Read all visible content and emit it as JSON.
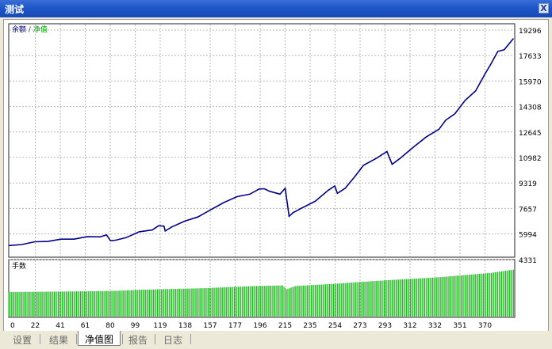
{
  "window": {
    "title": "测试",
    "close_label": "X"
  },
  "chart": {
    "legend_balance": "余额",
    "legend_sep": " / ",
    "legend_equity": "净值",
    "lower_label": "手数",
    "balance_color": "#00008b",
    "equity_color": "#00a000",
    "volume_color": "#00b000"
  },
  "chart_data": {
    "type": "line",
    "y_ticks": [
      "19296",
      "17633",
      "15970",
      "14308",
      "12645",
      "10982",
      "9319",
      "7657",
      "5994",
      "4331"
    ],
    "x_ticks": [
      "0",
      "22",
      "41",
      "61",
      "80",
      "99",
      "119",
      "138",
      "157",
      "177",
      "196",
      "215",
      "235",
      "254",
      "273",
      "293",
      "312",
      "332",
      "351",
      "370"
    ],
    "ylim": [
      4331,
      19296
    ],
    "balance": [
      [
        0,
        5000
      ],
      [
        10,
        5150
      ],
      [
        20,
        5250
      ],
      [
        30,
        5350
      ],
      [
        40,
        5420
      ],
      [
        50,
        5500
      ],
      [
        60,
        5580
      ],
      [
        70,
        5650
      ],
      [
        75,
        5700
      ],
      [
        78,
        5400
      ],
      [
        82,
        5350
      ],
      [
        90,
        5600
      ],
      [
        100,
        5900
      ],
      [
        110,
        6100
      ],
      [
        115,
        6300
      ],
      [
        119,
        6350
      ],
      [
        120,
        5950
      ],
      [
        125,
        6300
      ],
      [
        135,
        6600
      ],
      [
        145,
        6950
      ],
      [
        155,
        7350
      ],
      [
        165,
        7900
      ],
      [
        175,
        8200
      ],
      [
        185,
        8450
      ],
      [
        192,
        8700
      ],
      [
        196,
        8800
      ],
      [
        200,
        8550
      ],
      [
        208,
        8450
      ],
      [
        212,
        8750
      ],
      [
        215,
        7000
      ],
      [
        218,
        7150
      ],
      [
        225,
        7550
      ],
      [
        235,
        7900
      ],
      [
        245,
        8700
      ],
      [
        250,
        8900
      ],
      [
        252,
        8500
      ],
      [
        258,
        8750
      ],
      [
        265,
        9550
      ],
      [
        272,
        10250
      ],
      [
        282,
        10800
      ],
      [
        290,
        11150
      ],
      [
        294,
        10400
      ],
      [
        300,
        10700
      ],
      [
        310,
        11500
      ],
      [
        320,
        12100
      ],
      [
        330,
        12700
      ],
      [
        335,
        13200
      ],
      [
        342,
        13700
      ],
      [
        350,
        14500
      ],
      [
        358,
        15200
      ],
      [
        365,
        16200
      ],
      [
        370,
        17000
      ],
      [
        375,
        17700
      ],
      [
        380,
        17900
      ],
      [
        387,
        18550
      ]
    ],
    "volume": [
      [
        0,
        0.45
      ],
      [
        50,
        0.46
      ],
      [
        80,
        0.47
      ],
      [
        100,
        0.49
      ],
      [
        150,
        0.52
      ],
      [
        190,
        0.56
      ],
      [
        210,
        0.57
      ],
      [
        213,
        0.5
      ],
      [
        220,
        0.56
      ],
      [
        250,
        0.6
      ],
      [
        280,
        0.65
      ],
      [
        300,
        0.68
      ],
      [
        330,
        0.72
      ],
      [
        350,
        0.76
      ],
      [
        370,
        0.8
      ],
      [
        387,
        0.86
      ]
    ]
  },
  "tabs": [
    "设置",
    "结果",
    "净值图",
    "报告",
    "日志"
  ]
}
